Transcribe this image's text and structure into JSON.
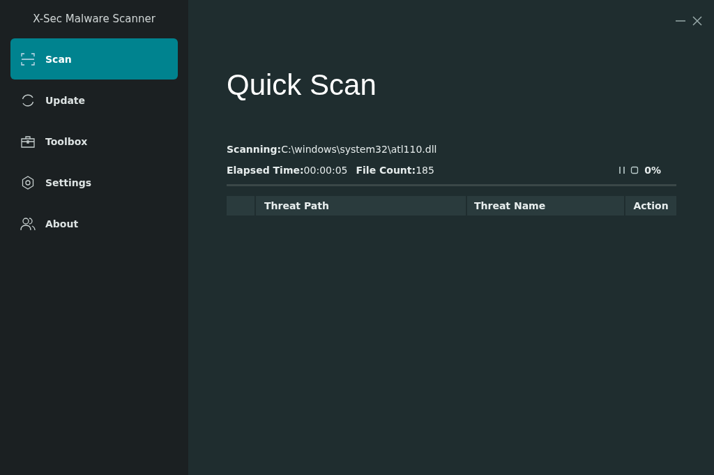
{
  "app": {
    "title": "X-Sec Malware Scanner"
  },
  "sidebar": {
    "items": [
      {
        "label": "Scan",
        "selected": true
      },
      {
        "label": "Update",
        "selected": false
      },
      {
        "label": "Toolbox",
        "selected": false
      },
      {
        "label": "Settings",
        "selected": false
      },
      {
        "label": "About",
        "selected": false
      }
    ]
  },
  "page": {
    "title": "Quick Scan",
    "scanning": "**Scanning:**C:\\windows\\system32\\atl110.dll",
    "elapsed": "**Elapsed Time:**00:00:05",
    "file_count": "**File Count:**185",
    "percent": "0%",
    "progress": {
      "level": 0
    }
  },
  "table": {
    "columns": [
      "Threat Path",
      "Threat Name",
      "Action"
    ]
  }
}
